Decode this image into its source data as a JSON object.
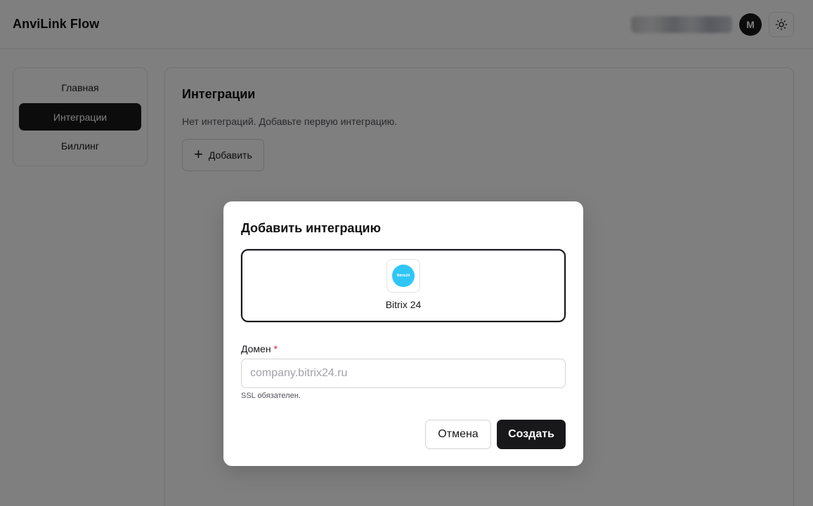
{
  "app": {
    "title": "AnviLink Flow"
  },
  "header": {
    "avatar_initial": "M",
    "theme_icon": "sun-icon"
  },
  "sidebar": {
    "items": [
      {
        "label": "Главная",
        "active": false
      },
      {
        "label": "Интеграции",
        "active": true
      },
      {
        "label": "Биллинг",
        "active": false
      }
    ]
  },
  "main": {
    "title": "Интеграции",
    "empty_text": "Нет интеграций. Добавьте первую интеграцию.",
    "add_button_label": "Добавить",
    "add_icon": "plus-icon"
  },
  "modal": {
    "title": "Добавить интеграцию",
    "options": [
      {
        "label": "Bitrix 24",
        "logo_text": "Bitrix24",
        "logo_color": "#2fc6f6",
        "selected": true
      }
    ],
    "domain_field": {
      "label": "Домен",
      "required_mark": "*",
      "placeholder": "company.bitrix24.ru",
      "value": "",
      "hint": "SSL обязателен."
    },
    "cancel_label": "Отмена",
    "create_label": "Создать"
  },
  "colors": {
    "primary": "#18181b",
    "overlay": "rgba(0,0,0,0.5)",
    "bitrix_blue": "#2fc6f6",
    "required": "#e11d48"
  }
}
